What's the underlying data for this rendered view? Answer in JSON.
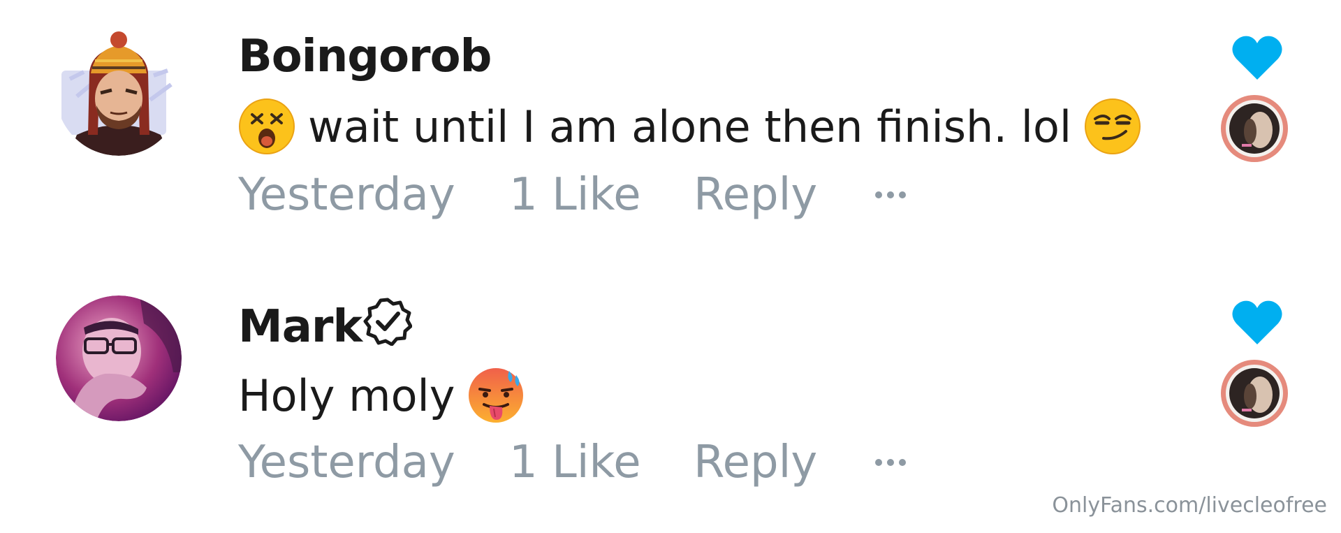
{
  "comments": [
    {
      "username": "Boingorob",
      "verified": false,
      "text": "wait until I am alone then finish. lol",
      "leading_emoji": "dizzy-face",
      "trailing_emoji": "smirking-face",
      "time": "Yesterday",
      "likes": "1 Like",
      "reply": "Reply",
      "liked": true
    },
    {
      "username": "Mark",
      "verified": true,
      "text": "Holy moly",
      "trailing_emoji": "hot-face",
      "time": "Yesterday",
      "likes": "1 Like",
      "reply": "Reply",
      "liked": true
    }
  ],
  "colors": {
    "heart": "#00aff0",
    "meta_text": "#8e9aa4",
    "creator_ring": "#e58a7c"
  },
  "watermark": "OnlyFans.com/livecleofree"
}
